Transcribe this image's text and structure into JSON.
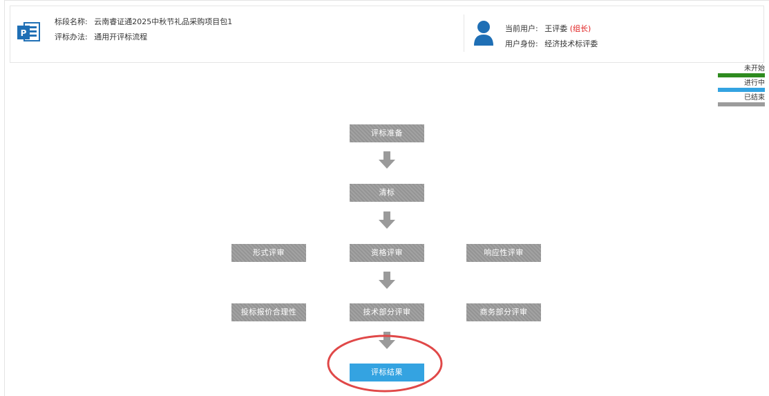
{
  "header": {
    "project_label": "标段名称:",
    "project_name": "云南睿证通2025中秋节礼品采购项目包1",
    "method_label": "评标办法:",
    "method_name": "通用开评标流程",
    "current_user_label": "当前用户:",
    "current_user_name": "王评委",
    "current_user_role": "(组长)",
    "identity_label": "用户身份:",
    "identity_value": "经济技术标评委"
  },
  "legend": {
    "items": [
      {
        "label": "未开始",
        "color": "#2e8b1f"
      },
      {
        "label": "进行中",
        "color": "#34a3e1"
      },
      {
        "label": "已结束",
        "color": "#9c9c9c"
      }
    ]
  },
  "flow": {
    "prepare": "评标准备",
    "clarify": "清标",
    "formal_review": "形式评审",
    "qualification_review": "资格评审",
    "response_review": "响应性评审",
    "price_review": "投标报价合理性",
    "technical_review": "技术部分评审",
    "business_review": "商务部分评审",
    "result": "评标结果"
  },
  "colors": {
    "step_default": "#9c9c9c",
    "step_active": "#34a3e1",
    "highlight": "#e04848"
  }
}
